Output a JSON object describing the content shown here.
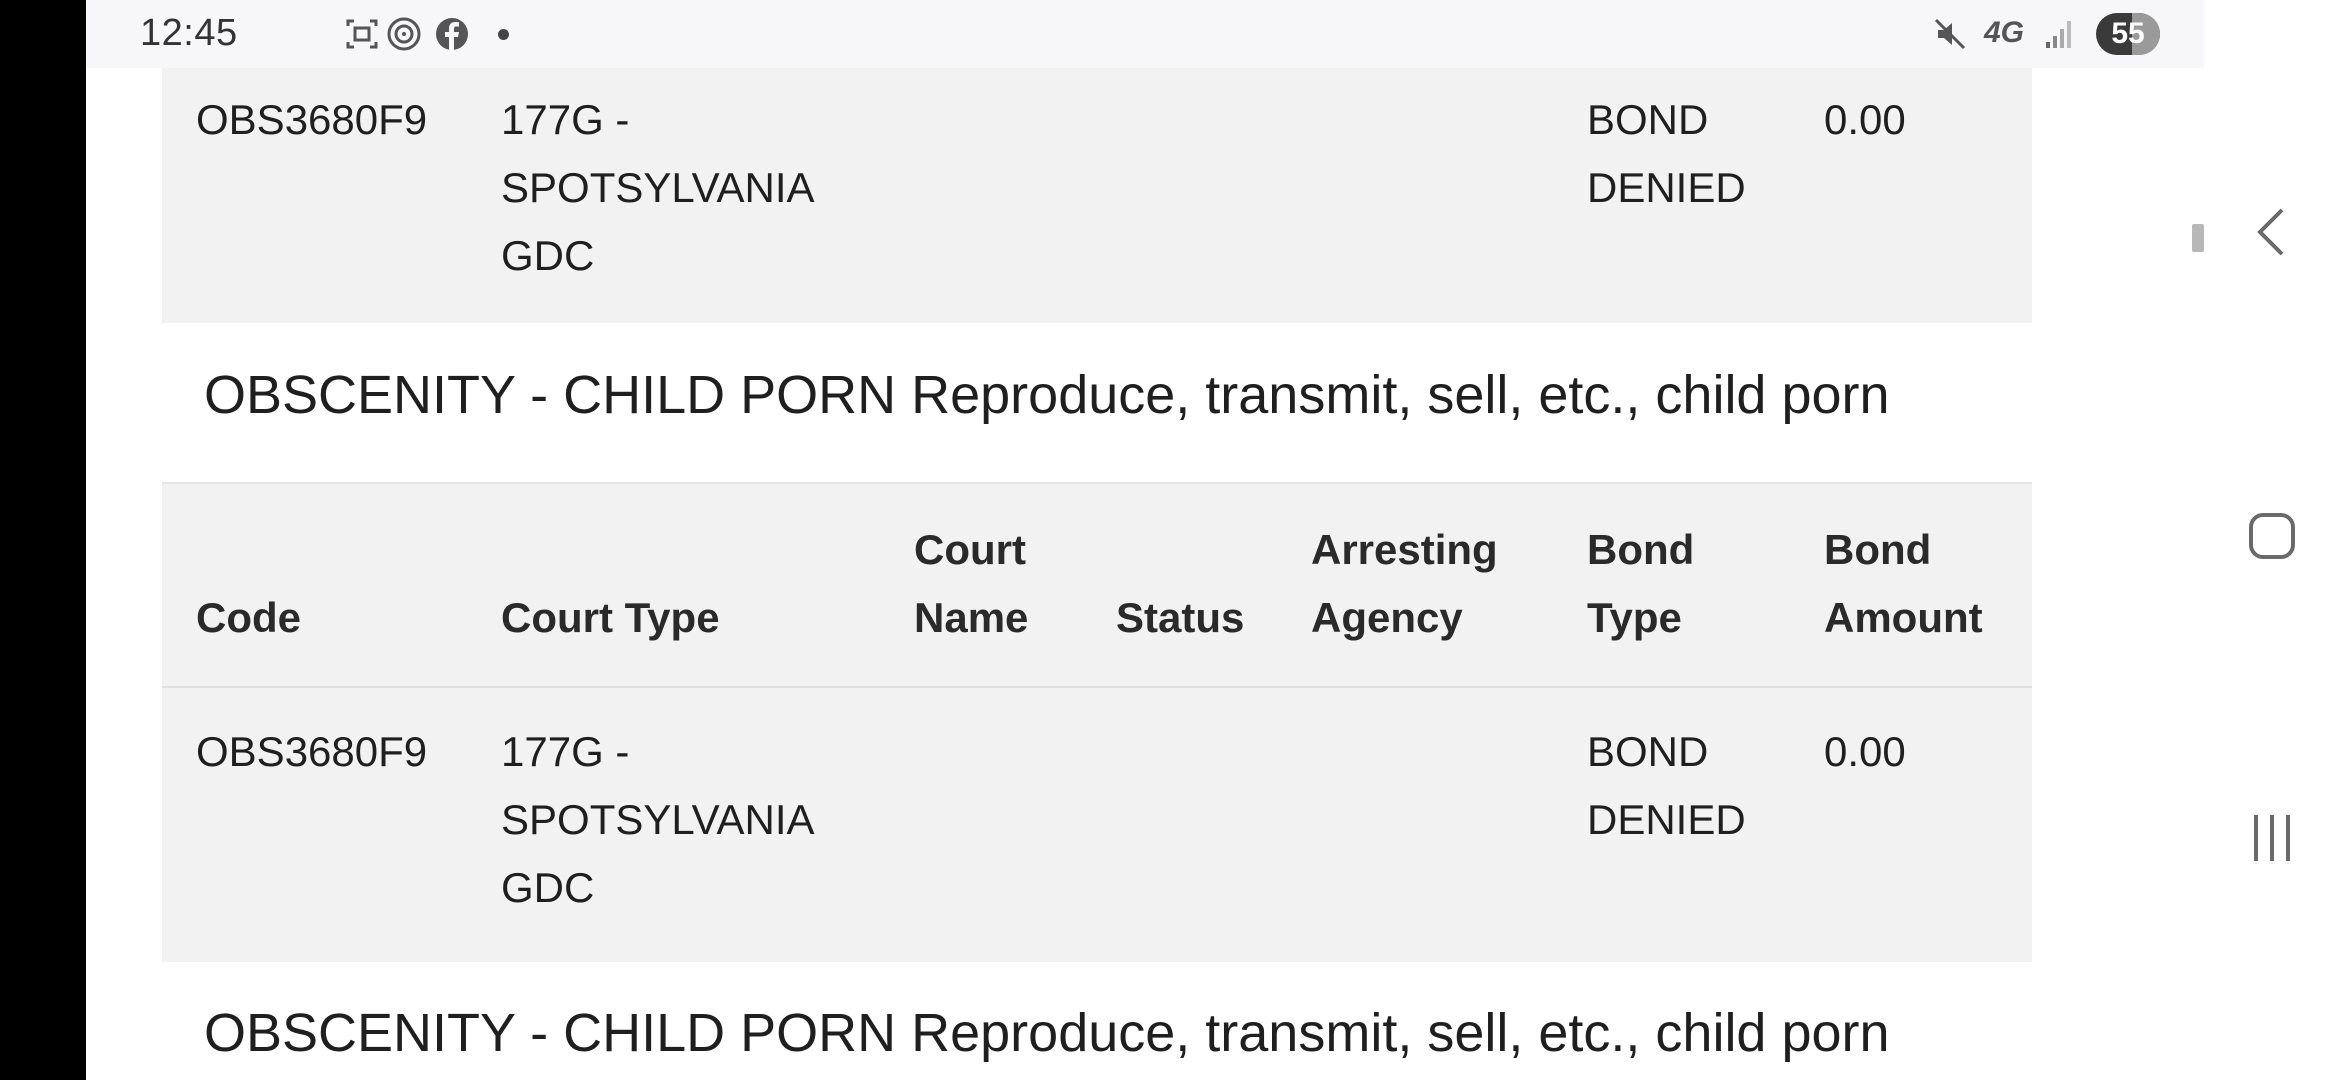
{
  "status_bar": {
    "time": "12:45",
    "network": "4G",
    "battery": "55",
    "icons": [
      "screenshot-icon",
      "threads-icon",
      "facebook-icon",
      "notification-dot-icon",
      "mute-icon",
      "signal-icon"
    ]
  },
  "columns": {
    "code": "Code",
    "court_type": "Court Type",
    "court_name": "Court\nName",
    "status": "Status",
    "arresting_agency": "Arresting\nAgency",
    "bond_type": "Bond\nType",
    "bond_amount": "Bond\nAmount"
  },
  "top_row": {
    "code": "OBS3680F9",
    "court_type": "177G -\nSPOTSYLVANIA\nGDC",
    "bond_type": "BOND\nDENIED",
    "bond_amount": "0.00"
  },
  "charge_1": {
    "title": "OBSCENITY - CHILD PORN Reproduce, transmit, sell, etc., child porn",
    "row": {
      "code": "OBS3680F9",
      "court_type": "177G -\nSPOTSYLVANIA\nGDC",
      "court_name": "",
      "status": "",
      "arresting_agency": "",
      "bond_type": "BOND\nDENIED",
      "bond_amount": "0.00"
    }
  },
  "charge_2": {
    "title": "OBSCENITY - CHILD PORN Reproduce, transmit, sell, etc., child porn"
  },
  "nav": {
    "icons": [
      "back-icon",
      "home-icon",
      "recents-icon"
    ]
  }
}
